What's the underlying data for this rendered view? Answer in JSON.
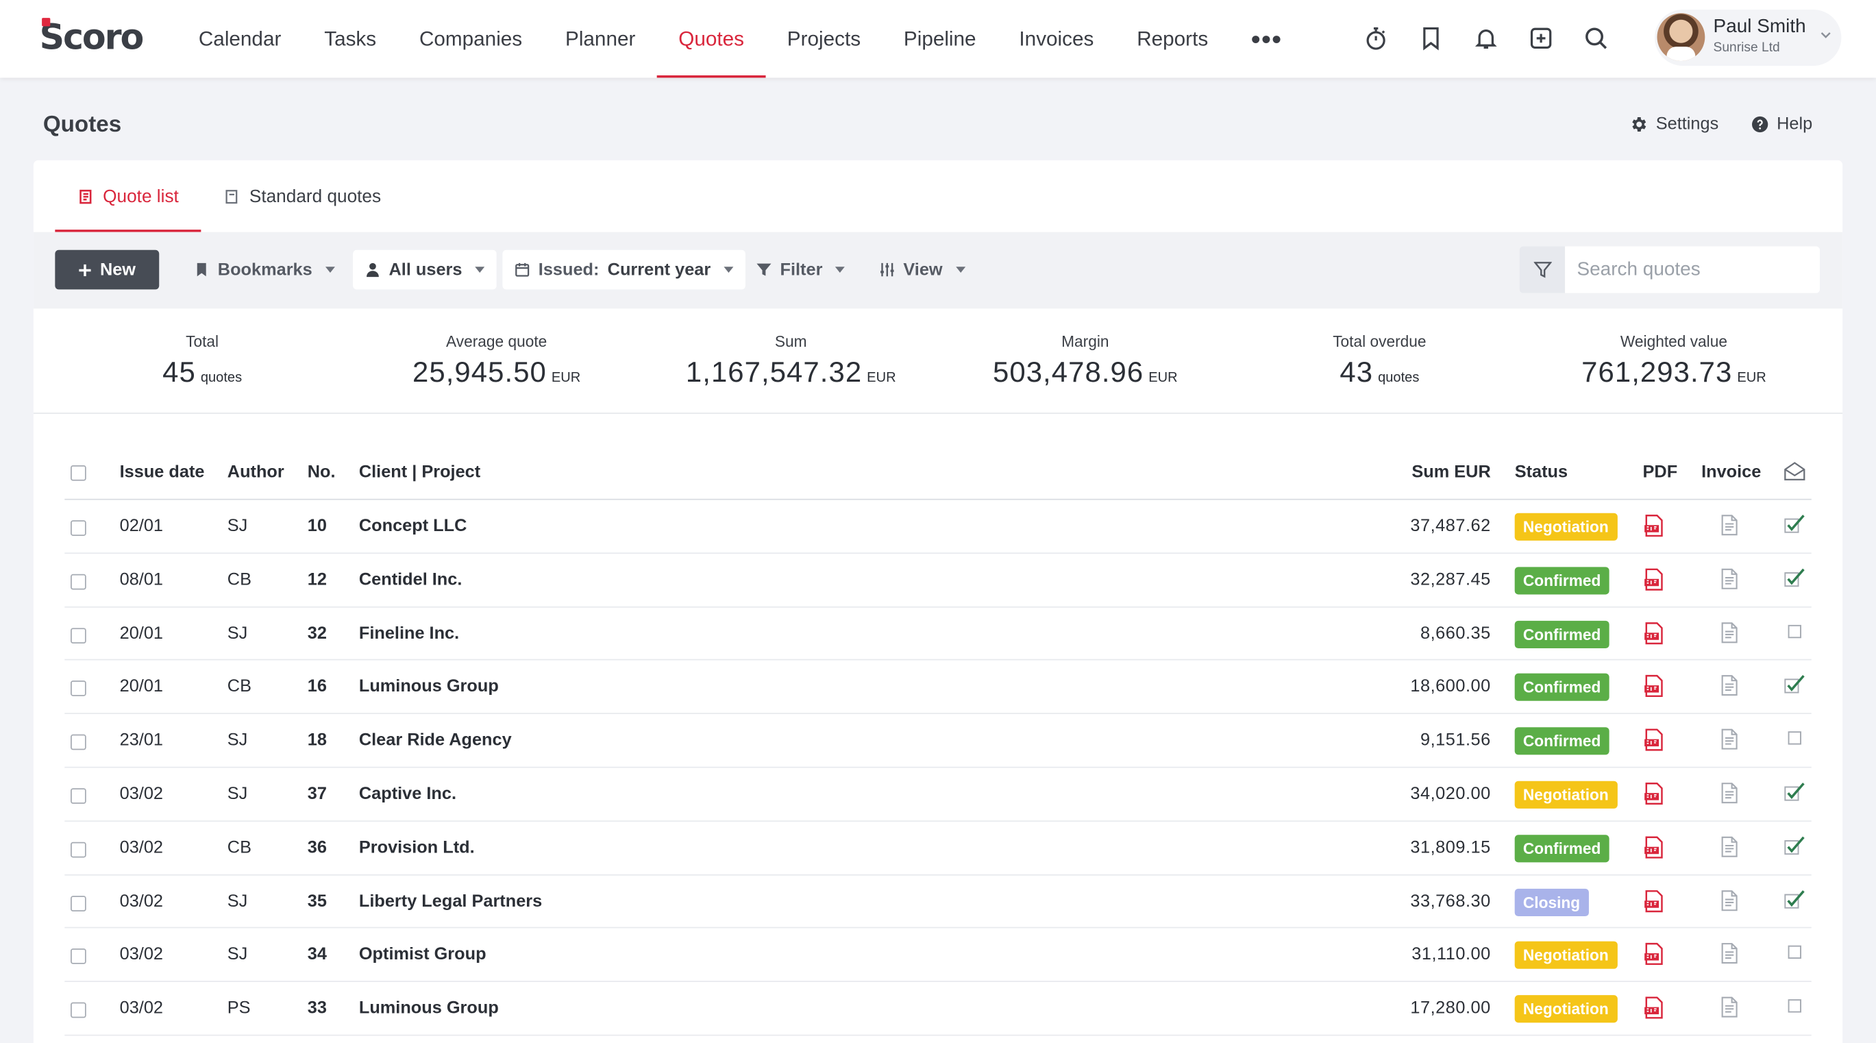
{
  "app": {
    "logo": "Scoro"
  },
  "nav": {
    "items": [
      "Calendar",
      "Tasks",
      "Companies",
      "Planner",
      "Quotes",
      "Projects",
      "Pipeline",
      "Invoices",
      "Reports"
    ],
    "active": "Quotes",
    "more": "•••"
  },
  "top_icons": [
    "stopwatch-icon",
    "bookmark-icon",
    "bell-icon",
    "plus-square-icon",
    "search-icon"
  ],
  "user": {
    "name": "Paul Smith",
    "company": "Sunrise Ltd"
  },
  "page": {
    "title": "Quotes",
    "settings_label": "Settings",
    "help_label": "Help"
  },
  "tabs": [
    {
      "label": "Quote list",
      "active": true
    },
    {
      "label": "Standard quotes",
      "active": false
    }
  ],
  "toolbar": {
    "new_label": "New",
    "bookmarks_label": "Bookmarks",
    "users_label": "All users",
    "issued_prefix": "Issued:",
    "issued_value": "Current year",
    "filter_label": "Filter",
    "view_label": "View",
    "search_placeholder": "Search quotes"
  },
  "summary": [
    {
      "label": "Total",
      "value": "45",
      "unit": "quotes"
    },
    {
      "label": "Average quote",
      "value": "25,945.50",
      "unit": "EUR"
    },
    {
      "label": "Sum",
      "value": "1,167,547.32",
      "unit": "EUR"
    },
    {
      "label": "Margin",
      "value": "503,478.96",
      "unit": "EUR"
    },
    {
      "label": "Total overdue",
      "value": "43",
      "unit": "quotes"
    },
    {
      "label": "Weighted value",
      "value": "761,293.73",
      "unit": "EUR"
    }
  ],
  "table": {
    "headers": {
      "issue_date": "Issue date",
      "author": "Author",
      "no": "No.",
      "client_project": "Client | Project",
      "sum": "Sum EUR",
      "status": "Status",
      "pdf": "PDF",
      "invoice": "Invoice"
    },
    "status_colors": {
      "Negotiation": "#f5c518",
      "Confirmed": "#5bae47",
      "Closing": "#a9b3ea"
    },
    "rows": [
      {
        "date": "02/01",
        "author": "SJ",
        "no": "10",
        "client": "Concept LLC",
        "sum": "37,487.62",
        "status": "Negotiation",
        "sent": true
      },
      {
        "date": "08/01",
        "author": "CB",
        "no": "12",
        "client": "Centidel Inc.",
        "sum": "32,287.45",
        "status": "Confirmed",
        "sent": true
      },
      {
        "date": "20/01",
        "author": "SJ",
        "no": "32",
        "client": "Fineline Inc.",
        "sum": "8,660.35",
        "status": "Confirmed",
        "sent": false
      },
      {
        "date": "20/01",
        "author": "CB",
        "no": "16",
        "client": "Luminous Group",
        "sum": "18,600.00",
        "status": "Confirmed",
        "sent": true
      },
      {
        "date": "23/01",
        "author": "SJ",
        "no": "18",
        "client": "Clear Ride Agency",
        "sum": "9,151.56",
        "status": "Confirmed",
        "sent": false
      },
      {
        "date": "03/02",
        "author": "SJ",
        "no": "37",
        "client": "Captive Inc.",
        "sum": "34,020.00",
        "status": "Negotiation",
        "sent": true
      },
      {
        "date": "03/02",
        "author": "CB",
        "no": "36",
        "client": "Provision Ltd.",
        "sum": "31,809.15",
        "status": "Confirmed",
        "sent": true
      },
      {
        "date": "03/02",
        "author": "SJ",
        "no": "35",
        "client": "Liberty Legal Partners",
        "sum": "33,768.30",
        "status": "Closing",
        "sent": true
      },
      {
        "date": "03/02",
        "author": "SJ",
        "no": "34",
        "client": "Optimist Group",
        "sum": "31,110.00",
        "status": "Negotiation",
        "sent": false
      },
      {
        "date": "03/02",
        "author": "PS",
        "no": "33",
        "client": "Luminous Group",
        "sum": "17,280.00",
        "status": "Negotiation",
        "sent": false
      }
    ]
  },
  "colors": {
    "accent": "#d9263c",
    "dark_button": "#474c55"
  }
}
